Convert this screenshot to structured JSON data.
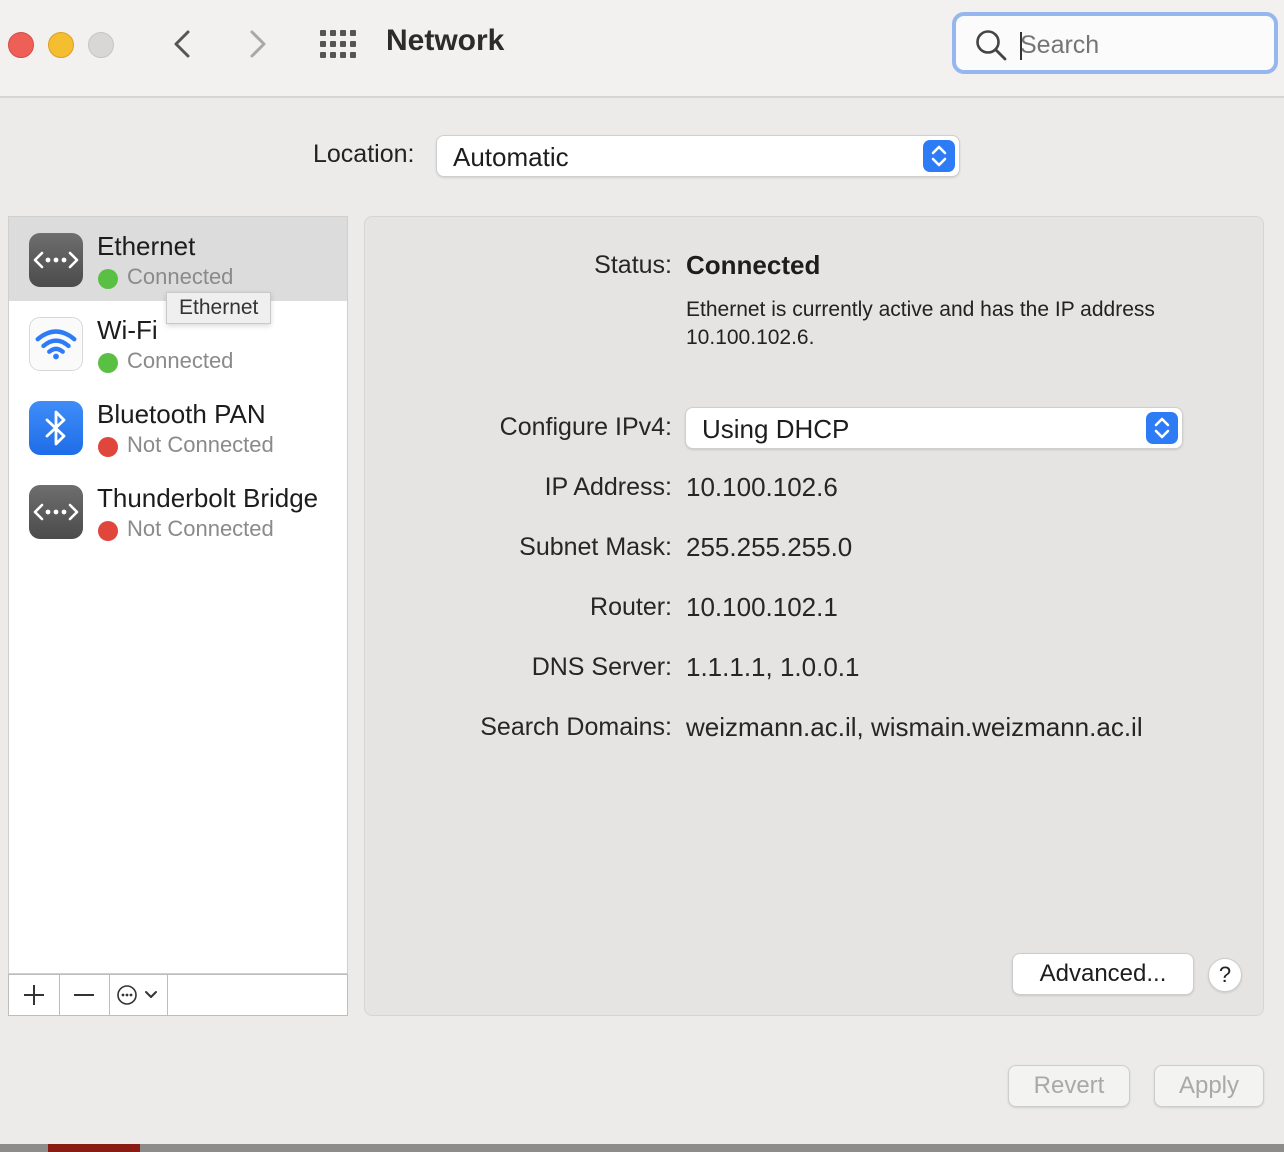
{
  "window": {
    "title": "Network",
    "traffic_lights": [
      "close",
      "minimize",
      "zoom"
    ]
  },
  "toolbar": {
    "back_icon": "chevron-left-icon",
    "forward_icon": "chevron-right-icon",
    "show_all_icon": "grid-icon",
    "search_placeholder": "Search"
  },
  "location": {
    "label": "Location:",
    "value": "Automatic"
  },
  "services": [
    {
      "name": "Ethernet",
      "status": "Connected",
      "status_color": "#5ac043",
      "icon": "ethernet-icon",
      "selected": true
    },
    {
      "name": "Wi-Fi",
      "status": "Connected",
      "status_color": "#5ac043",
      "icon": "wifi-icon",
      "selected": false
    },
    {
      "name": "Bluetooth PAN",
      "status": "Not Connected",
      "status_color": "#e0463c",
      "icon": "bluetooth-icon",
      "selected": false
    },
    {
      "name": "Thunderbolt Bridge",
      "status": "Not Connected",
      "status_color": "#e0463c",
      "icon": "ethernet-icon",
      "selected": false
    }
  ],
  "tooltip": "Ethernet",
  "sidebar_actions": [
    "plus-icon",
    "minus-icon",
    "more-options-icon"
  ],
  "detail": {
    "status_label": "Status:",
    "status_value": "Connected",
    "status_description": "Ethernet is currently active and has the IP address 10.100.102.6.",
    "configure_label": "Configure IPv4:",
    "configure_value": "Using DHCP",
    "fields": [
      {
        "label": "IP Address:",
        "value": "10.100.102.6"
      },
      {
        "label": "Subnet Mask:",
        "value": "255.255.255.0"
      },
      {
        "label": "Router:",
        "value": "10.100.102.1"
      },
      {
        "label": "DNS Server:",
        "value": "1.1.1.1, 1.0.0.1"
      },
      {
        "label": "Search Domains:",
        "value": "weizmann.ac.il, wismain.weizmann.ac.il"
      }
    ],
    "advanced_label": "Advanced...",
    "help_label": "?"
  },
  "footer": {
    "revert_label": "Revert",
    "apply_label": "Apply"
  },
  "colors": {
    "accent": "#2d7cf6",
    "connected": "#5ac043",
    "not_connected": "#e0463c"
  }
}
